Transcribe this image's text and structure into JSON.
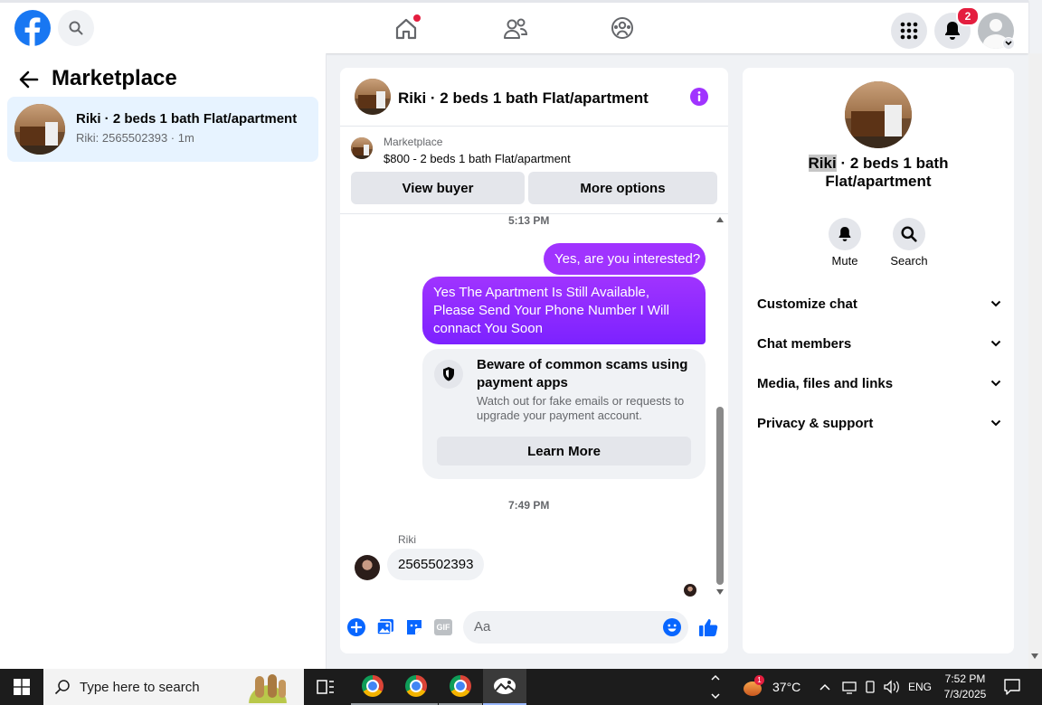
{
  "topbar": {
    "notification_count": "2",
    "brand_color": "#1877f2"
  },
  "left": {
    "title": "Marketplace",
    "conversation": {
      "title": "Riki · 2 beds 1 bath Flat/apartment",
      "subtitle": "Riki: 2565502393 · 1m"
    }
  },
  "chat": {
    "header_title": "Riki · 2 beds 1 bath Flat/apartment",
    "listing_source": "Marketplace",
    "listing_title": "$800 - 2 beds 1 bath Flat/apartment",
    "view_buyer_label": "View buyer",
    "more_options_label": "More options",
    "time_1": "5:13 PM",
    "msg_1": "Yes, are you interested?",
    "msg_2": "Yes The Apartment Is Still Available, Please Send Your Phone Number I Will connact You Soon",
    "scam_title": "Beware of common scams using payment apps",
    "scam_body": "Watch out for fake emails or requests to upgrade your payment account.",
    "learn_more_label": "Learn More",
    "time_2": "7:49 PM",
    "sender_name": "Riki",
    "msg_3": "2565502393",
    "composer_placeholder": "Aa",
    "gif_label": "GIF",
    "accent_color": "#a033ff"
  },
  "right": {
    "title_highlight": "Riki",
    "title_rest_line1": " · 2 beds 1 bath",
    "title_line2": "Flat/apartment",
    "mute_label": "Mute",
    "search_label": "Search",
    "sections": [
      "Customize chat",
      "Chat members",
      "Media, files and links",
      "Privacy & support"
    ]
  },
  "taskbar": {
    "search_placeholder": "Type here to search",
    "weather_badge": "1",
    "temperature": "37°C",
    "language": "ENG",
    "time": "7:52 PM",
    "date": "7/3/2025"
  }
}
